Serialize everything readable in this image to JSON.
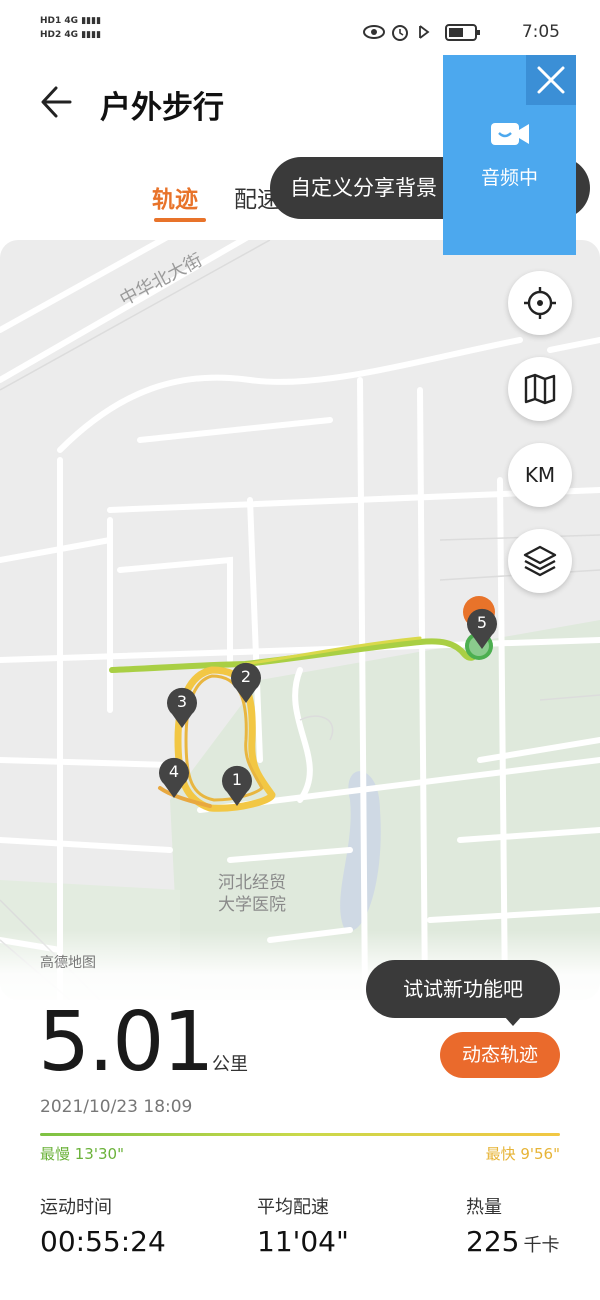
{
  "status_bar": {
    "sim_label": "HD",
    "network": "4G",
    "time": "7:05"
  },
  "header": {
    "title": "户外步行"
  },
  "tabs": [
    {
      "label": "轨迹"
    },
    {
      "label": "配速"
    }
  ],
  "toast": {
    "text": "自定义分享背景"
  },
  "audio_overlay": {
    "label": "音频中",
    "close_icon": "close-icon",
    "icon": "video-camera-icon"
  },
  "map": {
    "road_label": "中华北大街",
    "poi_label_line1": "河北经贸",
    "poi_label_line2": "大学医院",
    "credit": "高德地图",
    "markers": [
      "1",
      "2",
      "3",
      "4",
      "5"
    ],
    "buttons": [
      {
        "name": "locate-button",
        "icon": "crosshair-icon"
      },
      {
        "name": "map-type-button",
        "icon": "map-icon"
      },
      {
        "name": "unit-button",
        "label": "KM"
      },
      {
        "name": "layers-button",
        "icon": "layers-icon"
      }
    ]
  },
  "summary": {
    "distance": "5.01",
    "distance_unit": "公里",
    "datetime": "2021/10/23 18:09",
    "tooltip": "试试新功能吧",
    "dynamic_track_button": "动态轨迹",
    "slowest": "最慢 13'30\"",
    "fastest": "最快 9'56\""
  },
  "stats": [
    {
      "label": "运动时间",
      "value": "00:55:24",
      "unit": ""
    },
    {
      "label": "平均配速",
      "value": "11'04\"",
      "unit": ""
    },
    {
      "label": "热量",
      "value": "225",
      "unit": "千卡"
    }
  ],
  "colors": {
    "accent": "#e8732a",
    "track_green": "#8cc63f",
    "track_yellow": "#f2c744",
    "audio_blue": "#4ca8ee"
  }
}
